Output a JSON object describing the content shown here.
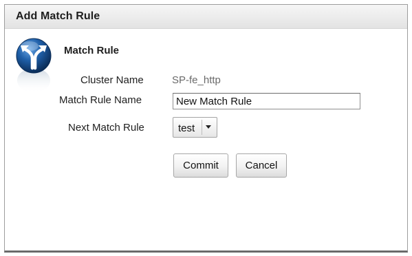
{
  "dialog": {
    "title": "Add Match Rule"
  },
  "section": {
    "title": "Match Rule",
    "icon": "fork-arrows-icon"
  },
  "form": {
    "cluster_name_label": "Cluster Name",
    "cluster_name_value": "SP-fe_http",
    "match_rule_name_label": "Match Rule Name",
    "match_rule_name_value": "New Match Rule",
    "next_match_rule_label": "Next Match Rule",
    "next_match_rule_value": "test"
  },
  "buttons": {
    "commit_label": "Commit",
    "cancel_label": "Cancel"
  },
  "colors": {
    "icon_blue": "#1f5fa8",
    "titlebar": "#ececec"
  }
}
